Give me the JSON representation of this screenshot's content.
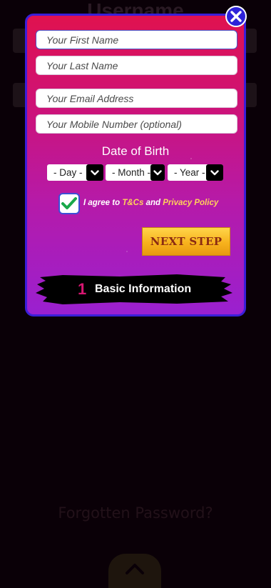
{
  "background": {
    "title": "Username",
    "forgot_password": "Forgotten Password?",
    "scroll_top_icon": "chevron-up-icon"
  },
  "modal": {
    "close_icon": "close-icon",
    "fields": {
      "first_name_placeholder": "Your First Name",
      "last_name_placeholder": "Your Last Name",
      "email_placeholder": "Your Email Address",
      "mobile_placeholder": "Your Mobile Number (optional)"
    },
    "dob": {
      "label": "Date of Birth",
      "day": "- Day -",
      "month": "- Month -",
      "year": "- Year -"
    },
    "agree": {
      "prefix": "I agree to",
      "tcs": "T&Cs",
      "and": "and",
      "privacy": "Privacy Policy",
      "checked": true
    },
    "next_button": "NEXT STEP",
    "step": {
      "number": "1",
      "label": "Basic Information"
    }
  },
  "colors": {
    "accent_blue": "#2d23d9",
    "link_yellow": "#ffd15a",
    "check_green": "#19a84a",
    "step_pink": "#d81672"
  }
}
